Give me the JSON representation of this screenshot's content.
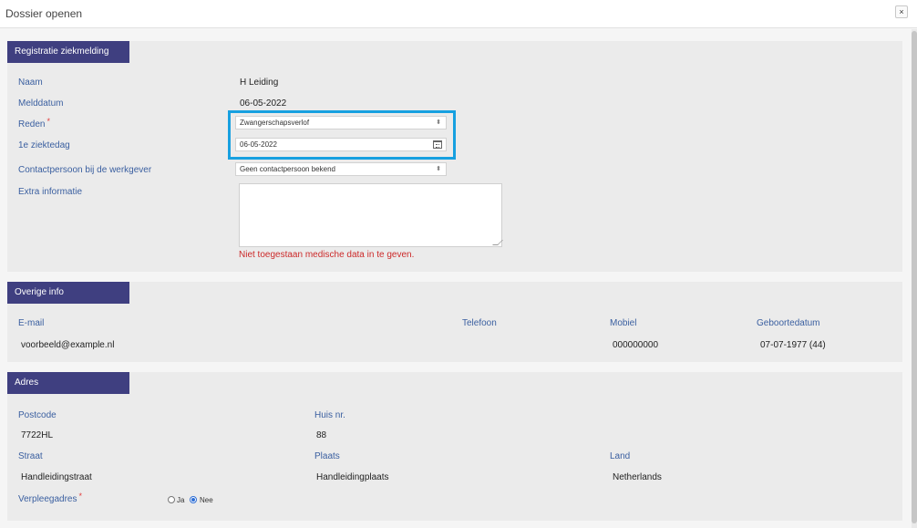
{
  "modal": {
    "title": "Dossier openen",
    "close_label": "×"
  },
  "registration": {
    "header": "Registratie ziekmelding",
    "naam_label": "Naam",
    "naam_value": "H Leiding",
    "melddatum_label": "Melddatum",
    "melddatum_value": "06-05-2022",
    "reden_label": "Reden",
    "reden_value": "Zwangerschapsverlof",
    "ziektedag_label": "1e ziektedag",
    "ziektedag_value": "06-05-2022",
    "contact_label": "Contactpersoon bij de werkgever",
    "contact_value": "Geen contactpersoon bekend",
    "extra_label": "Extra informatie",
    "warning": "Niet toegestaan medische data in te geven.",
    "required_mark": "*"
  },
  "overige": {
    "header": "Overige info",
    "email_label": "E-mail",
    "email_value": "voorbeeld@example.nl",
    "telefoon_label": "Telefoon",
    "telefoon_value": "",
    "mobiel_label": "Mobiel",
    "mobiel_value": "000000000",
    "geboorte_label": "Geboortedatum",
    "geboorte_value": "07-07-1977 (44)"
  },
  "adres": {
    "header": "Adres",
    "postcode_label": "Postcode",
    "postcode_value": "7722HL",
    "huisnr_label": "Huis nr.",
    "huisnr_value": "88",
    "straat_label": "Straat",
    "straat_value": "Handleidingstraat",
    "plaats_label": "Plaats",
    "plaats_value": "Handleidingplaats",
    "land_label": "Land",
    "land_value": "Netherlands",
    "verpleeg_label": "Verpleegadres",
    "required_mark": "*",
    "ja_label": "Ja",
    "nee_label": "Nee",
    "selected": "Nee"
  },
  "icons": {
    "select_arrow": "⬍"
  },
  "colors": {
    "section_header": "#3f3f80",
    "label": "#3a5fa0",
    "warning": "#cc2a2a",
    "highlight": "#17a0e0"
  }
}
